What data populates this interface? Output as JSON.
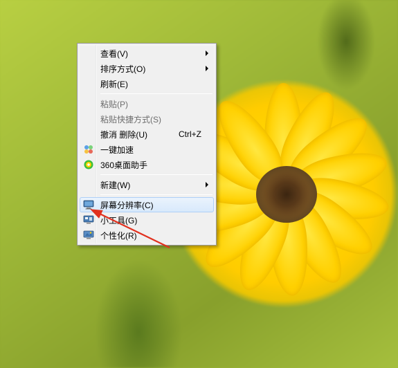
{
  "menu": {
    "items": [
      {
        "label": "查看(V)",
        "submenu": true
      },
      {
        "label": "排序方式(O)",
        "submenu": true
      },
      {
        "label": "刷新(E)"
      }
    ],
    "items2": [
      {
        "label": "粘贴(P)",
        "disabled": true
      },
      {
        "label": "粘贴快捷方式(S)",
        "disabled": true
      },
      {
        "label": "撤消 删除(U)",
        "shortcut": "Ctrl+Z"
      },
      {
        "label": "一键加速",
        "icon": "speed"
      },
      {
        "label": "360桌面助手",
        "icon": "360"
      }
    ],
    "items3": [
      {
        "label": "新建(W)",
        "submenu": true
      }
    ],
    "items4": [
      {
        "label": "屏幕分辨率(C)",
        "icon": "monitor",
        "highlight": true
      },
      {
        "label": "小工具(G)",
        "icon": "gadget"
      },
      {
        "label": "个性化(R)",
        "icon": "personalize"
      }
    ]
  }
}
